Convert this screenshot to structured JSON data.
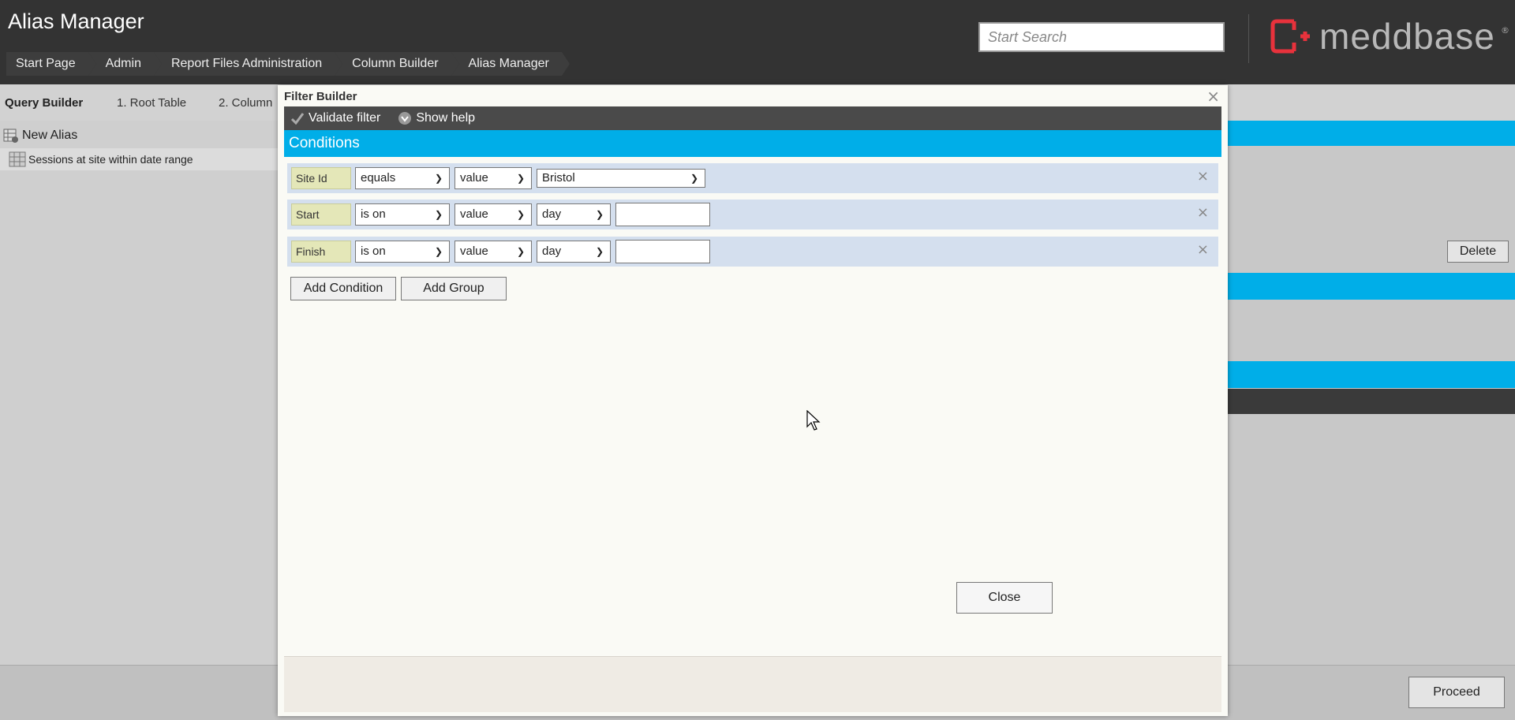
{
  "header": {
    "title": "Alias Manager",
    "search_placeholder": "Start Search",
    "logo_text": "meddbase",
    "logo_reg": "®",
    "breadcrumbs": [
      "Start Page",
      "Admin",
      "Report Files Administration",
      "Column Builder",
      "Alias Manager"
    ]
  },
  "query_builder": {
    "title": "Query Builder",
    "steps": [
      "1. Root Table",
      "2. Column"
    ]
  },
  "left_panel": {
    "new_alias": "New Alias",
    "aliases": [
      "Sessions at site within date range"
    ]
  },
  "right_panel": {
    "delete_label": "Delete"
  },
  "bottom": {
    "proceed_label": "Proceed"
  },
  "dialog": {
    "title": "Filter Builder",
    "close_icon": "×",
    "toolbar": {
      "validate_label": "Validate filter",
      "help_label": "Show help"
    },
    "conditions_header": "Conditions",
    "conditions": [
      {
        "field": "Site Id",
        "operator": "equals",
        "type": "value",
        "value": "Bristol"
      },
      {
        "field": "Start",
        "operator": "is on",
        "type": "value",
        "unit": "day",
        "value": ""
      },
      {
        "field": "Finish",
        "operator": "is on",
        "type": "value",
        "unit": "day",
        "value": ""
      }
    ],
    "remove_icon": "×",
    "add_condition_label": "Add Condition",
    "add_group_label": "Add Group",
    "close_label": "Close"
  },
  "colors": {
    "header_bg": "#333333",
    "accent_blue": "#00aee8",
    "logo_red": "#e8323c",
    "field_tag_bg": "#e4e7b8",
    "row_bg": "#d4dfee"
  }
}
